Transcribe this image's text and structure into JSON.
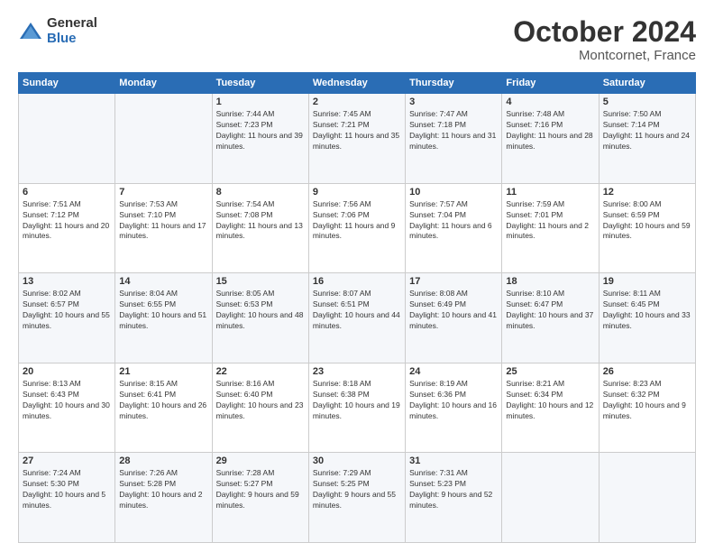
{
  "header": {
    "logo_general": "General",
    "logo_blue": "Blue",
    "month_title": "October 2024",
    "location": "Montcornet, France"
  },
  "days_of_week": [
    "Sunday",
    "Monday",
    "Tuesday",
    "Wednesday",
    "Thursday",
    "Friday",
    "Saturday"
  ],
  "weeks": [
    [
      {
        "day": "",
        "info": ""
      },
      {
        "day": "",
        "info": ""
      },
      {
        "day": "1",
        "info": "Sunrise: 7:44 AM\nSunset: 7:23 PM\nDaylight: 11 hours and 39 minutes."
      },
      {
        "day": "2",
        "info": "Sunrise: 7:45 AM\nSunset: 7:21 PM\nDaylight: 11 hours and 35 minutes."
      },
      {
        "day": "3",
        "info": "Sunrise: 7:47 AM\nSunset: 7:18 PM\nDaylight: 11 hours and 31 minutes."
      },
      {
        "day": "4",
        "info": "Sunrise: 7:48 AM\nSunset: 7:16 PM\nDaylight: 11 hours and 28 minutes."
      },
      {
        "day": "5",
        "info": "Sunrise: 7:50 AM\nSunset: 7:14 PM\nDaylight: 11 hours and 24 minutes."
      }
    ],
    [
      {
        "day": "6",
        "info": "Sunrise: 7:51 AM\nSunset: 7:12 PM\nDaylight: 11 hours and 20 minutes."
      },
      {
        "day": "7",
        "info": "Sunrise: 7:53 AM\nSunset: 7:10 PM\nDaylight: 11 hours and 17 minutes."
      },
      {
        "day": "8",
        "info": "Sunrise: 7:54 AM\nSunset: 7:08 PM\nDaylight: 11 hours and 13 minutes."
      },
      {
        "day": "9",
        "info": "Sunrise: 7:56 AM\nSunset: 7:06 PM\nDaylight: 11 hours and 9 minutes."
      },
      {
        "day": "10",
        "info": "Sunrise: 7:57 AM\nSunset: 7:04 PM\nDaylight: 11 hours and 6 minutes."
      },
      {
        "day": "11",
        "info": "Sunrise: 7:59 AM\nSunset: 7:01 PM\nDaylight: 11 hours and 2 minutes."
      },
      {
        "day": "12",
        "info": "Sunrise: 8:00 AM\nSunset: 6:59 PM\nDaylight: 10 hours and 59 minutes."
      }
    ],
    [
      {
        "day": "13",
        "info": "Sunrise: 8:02 AM\nSunset: 6:57 PM\nDaylight: 10 hours and 55 minutes."
      },
      {
        "day": "14",
        "info": "Sunrise: 8:04 AM\nSunset: 6:55 PM\nDaylight: 10 hours and 51 minutes."
      },
      {
        "day": "15",
        "info": "Sunrise: 8:05 AM\nSunset: 6:53 PM\nDaylight: 10 hours and 48 minutes."
      },
      {
        "day": "16",
        "info": "Sunrise: 8:07 AM\nSunset: 6:51 PM\nDaylight: 10 hours and 44 minutes."
      },
      {
        "day": "17",
        "info": "Sunrise: 8:08 AM\nSunset: 6:49 PM\nDaylight: 10 hours and 41 minutes."
      },
      {
        "day": "18",
        "info": "Sunrise: 8:10 AM\nSunset: 6:47 PM\nDaylight: 10 hours and 37 minutes."
      },
      {
        "day": "19",
        "info": "Sunrise: 8:11 AM\nSunset: 6:45 PM\nDaylight: 10 hours and 33 minutes."
      }
    ],
    [
      {
        "day": "20",
        "info": "Sunrise: 8:13 AM\nSunset: 6:43 PM\nDaylight: 10 hours and 30 minutes."
      },
      {
        "day": "21",
        "info": "Sunrise: 8:15 AM\nSunset: 6:41 PM\nDaylight: 10 hours and 26 minutes."
      },
      {
        "day": "22",
        "info": "Sunrise: 8:16 AM\nSunset: 6:40 PM\nDaylight: 10 hours and 23 minutes."
      },
      {
        "day": "23",
        "info": "Sunrise: 8:18 AM\nSunset: 6:38 PM\nDaylight: 10 hours and 19 minutes."
      },
      {
        "day": "24",
        "info": "Sunrise: 8:19 AM\nSunset: 6:36 PM\nDaylight: 10 hours and 16 minutes."
      },
      {
        "day": "25",
        "info": "Sunrise: 8:21 AM\nSunset: 6:34 PM\nDaylight: 10 hours and 12 minutes."
      },
      {
        "day": "26",
        "info": "Sunrise: 8:23 AM\nSunset: 6:32 PM\nDaylight: 10 hours and 9 minutes."
      }
    ],
    [
      {
        "day": "27",
        "info": "Sunrise: 7:24 AM\nSunset: 5:30 PM\nDaylight: 10 hours and 5 minutes."
      },
      {
        "day": "28",
        "info": "Sunrise: 7:26 AM\nSunset: 5:28 PM\nDaylight: 10 hours and 2 minutes."
      },
      {
        "day": "29",
        "info": "Sunrise: 7:28 AM\nSunset: 5:27 PM\nDaylight: 9 hours and 59 minutes."
      },
      {
        "day": "30",
        "info": "Sunrise: 7:29 AM\nSunset: 5:25 PM\nDaylight: 9 hours and 55 minutes."
      },
      {
        "day": "31",
        "info": "Sunrise: 7:31 AM\nSunset: 5:23 PM\nDaylight: 9 hours and 52 minutes."
      },
      {
        "day": "",
        "info": ""
      },
      {
        "day": "",
        "info": ""
      }
    ]
  ]
}
